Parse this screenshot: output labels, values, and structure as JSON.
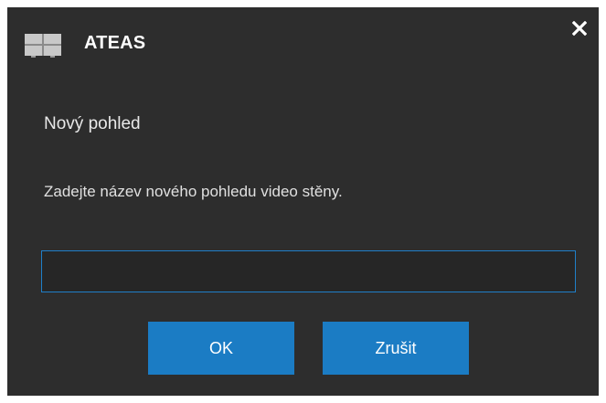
{
  "window": {
    "title": "ATEAS",
    "icon": "video-wall-icon",
    "close_icon": "close-icon"
  },
  "dialog": {
    "heading": "Nový pohled",
    "prompt": "Zadejte název nového pohledu video stěny.",
    "input_value": "",
    "input_placeholder": ""
  },
  "buttons": {
    "ok_label": "OK",
    "cancel_label": "Zrušit"
  },
  "colors": {
    "background": "#2d2d2d",
    "accent": "#1b7cc4",
    "input_border": "#1f7fc9",
    "text": "#e6e6e6"
  }
}
